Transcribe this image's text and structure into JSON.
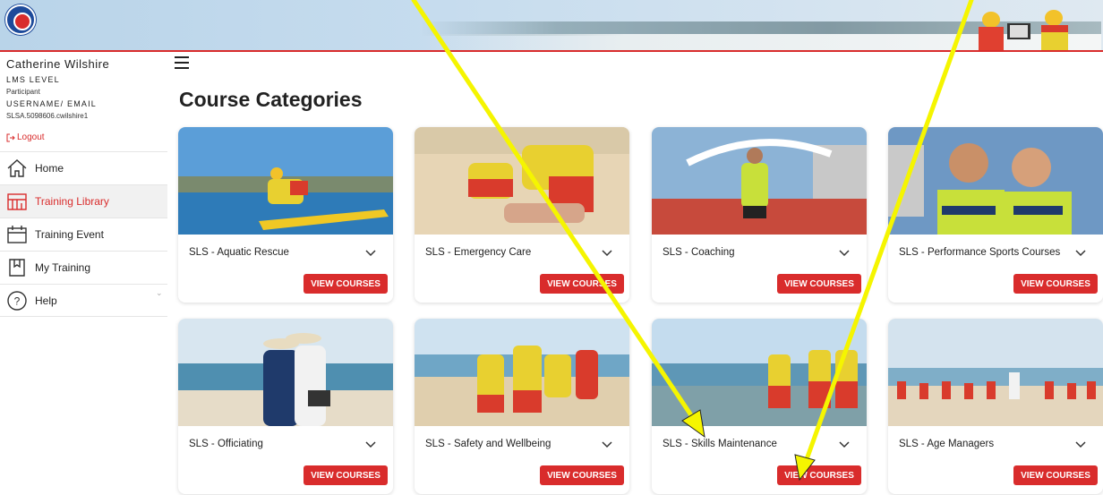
{
  "user": {
    "name": "Catherine Wilshire",
    "lms_level_label": "LMS LEVEL",
    "lms_level_value": "Participant",
    "username_label": "USERNAME/ EMAIL",
    "username_value": "SLSA.5098606.cwilshire1",
    "logout": "Logout"
  },
  "nav": [
    {
      "label": "Home",
      "icon": "home-icon"
    },
    {
      "label": "Training Library",
      "icon": "library-icon",
      "active": true
    },
    {
      "label": "Training Event",
      "icon": "calendar-icon"
    },
    {
      "label": "My Training",
      "icon": "book-icon"
    },
    {
      "label": "Help",
      "icon": "help-icon"
    }
  ],
  "page_title": "Course Categories",
  "view_label": "VIEW COURSES",
  "categories": [
    {
      "name": "SLS - Aquatic Rescue"
    },
    {
      "name": "SLS - Emergency Care"
    },
    {
      "name": "SLS - Coaching"
    },
    {
      "name": "SLS - Performance Sports Courses"
    },
    {
      "name": "SLS - Officiating"
    },
    {
      "name": "SLS - Safety and Wellbeing"
    },
    {
      "name": "SLS - Skills Maintenance"
    },
    {
      "name": "SLS - Age Managers"
    }
  ],
  "colors": {
    "accent": "#d92c2c",
    "annotation_arrow": "#f5f500"
  }
}
